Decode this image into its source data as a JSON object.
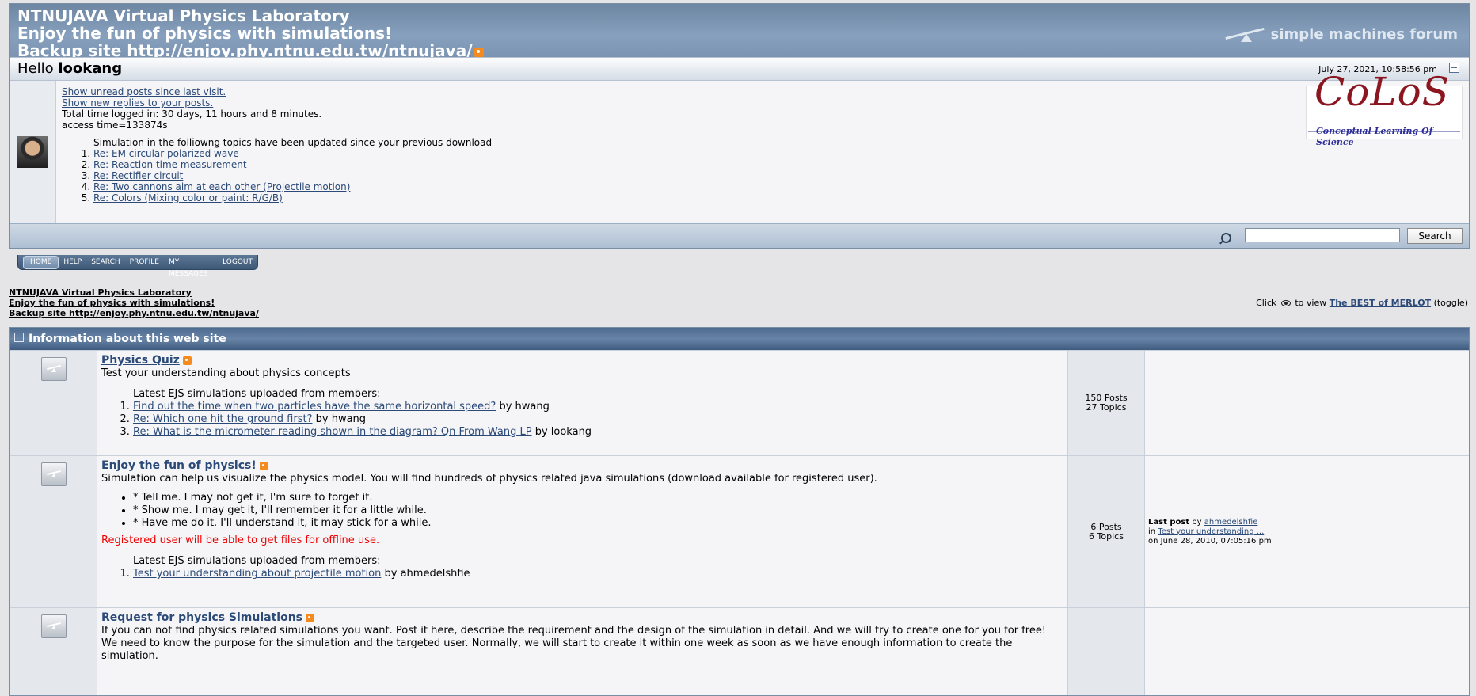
{
  "header": {
    "title_line1": "NTNUJAVA Virtual Physics Laboratory",
    "title_line2": "Enjoy the fun of physics with simulations!",
    "title_line3": "Backup site http://enjoy.phy.ntnu.edu.tw/ntnujava/",
    "forum_logo": "simple machines forum"
  },
  "user": {
    "hello": "Hello",
    "name": "lookang",
    "date": "July 27, 2021, 10:58:56 pm",
    "unread_link": "Show unread posts since last visit.",
    "replies_link": "Show new replies to your posts.",
    "time_logged": "Total time logged in: 30 days, 11 hours and 8 minutes.",
    "access_time": "access time=133874s",
    "updated_title": "Simulation in the folliowng topics have been updated since your previous download",
    "updated_topics": [
      "Re: EM circular polarized wave",
      "Re: Reaction time measurement",
      "Re: Rectifier circuit",
      "Re: Two cannons aim at each other (Projectile motion)",
      "Re: Colors (Mixing color or paint: R/G/B)"
    ]
  },
  "colos": {
    "main": "CoLoS",
    "sub": "Conceptual Learning Of Science"
  },
  "search": {
    "button": "Search",
    "value": ""
  },
  "nav": {
    "tabs": [
      "HOME",
      "HELP",
      "SEARCH",
      "PROFILE",
      "MY MESSAGES",
      "LOGOUT"
    ]
  },
  "linktree": [
    "NTNUJAVA Virtual Physics Laboratory",
    "Enjoy the fun of physics with simulations!",
    "Backup site http://enjoy.phy.ntnu.edu.tw/ntnujava/"
  ],
  "toggle": {
    "prefix": "Click",
    "middle": "to view",
    "link": "The BEST of MERLOT",
    "suffix": "(toggle)"
  },
  "category": {
    "title": "Information about this web site",
    "boards": [
      {
        "name": "Physics Quiz",
        "description": "Test your understanding about physics concepts",
        "latest_title": "Latest EJS simulations uploaded from members:",
        "latest": [
          {
            "link": "Find out the time when two particles have the same horizontal speed?",
            "by": "by hwang"
          },
          {
            "link": "Re: Which one hit the ground first?",
            "by": "by hwang"
          },
          {
            "link": "Re: What is the micrometer reading shown in the diagram? Qn From Wang LP",
            "by": "by lookang"
          }
        ],
        "posts": "150 Posts",
        "topics": "27 Topics"
      },
      {
        "name": "Enjoy the fun of physics!",
        "description": "Simulation can help us visualize the physics model. You will find hundreds of physics related java simulations (download available for registered user).",
        "bullets": [
          "* Tell me. I may not get it, I'm sure to forget it.",
          "* Show me. I may get it, I'll remember it for a little while.",
          "* Have me do it. I'll understand it, it may stick for a while."
        ],
        "warning": "Registered user will be able to get files for offline use.",
        "latest_title": "Latest EJS simulations uploaded from members:",
        "latest": [
          {
            "link": "Test your understanding about projectile motion",
            "by": "by ahmedelshfie"
          }
        ],
        "posts": "6 Posts",
        "topics": "6 Topics",
        "last_post_label": "Last post",
        "last_post_by": "by",
        "last_post_user": "ahmedelshfie",
        "last_post_in": "in",
        "last_post_topic": "Test your understanding ...",
        "last_post_date": "on June 28, 2010, 07:05:16 pm"
      },
      {
        "name": "Request for physics Simulations",
        "description": "If you can not find physics related simulations you want. Post it here, describe the requirement and the design of the simulation in detail. And we will try to create one for you for free! We need to know the purpose for the simulation and the targeted user. Normally, we will start to create it within one week as soon as we have enough information to create the simulation."
      }
    ]
  }
}
